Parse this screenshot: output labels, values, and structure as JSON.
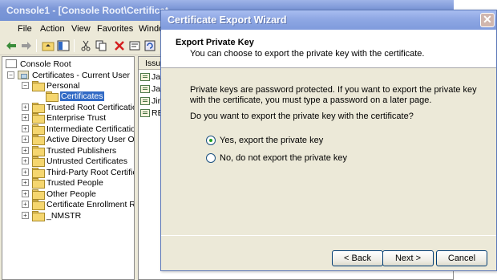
{
  "mmc": {
    "title": "Console1 - [Console Root\\Certificat",
    "menu": [
      "File",
      "Action",
      "View",
      "Favorites",
      "Windo"
    ],
    "toolbar_icons": [
      "back-arrow-icon",
      "forward-arrow-icon",
      "up-folder-icon",
      "show-tree-icon",
      "cut-icon",
      "copy-icon",
      "delete-icon",
      "properties-icon",
      "refresh-icon"
    ],
    "tree": {
      "root": "Console Root",
      "certificates_current_user": "Certificates - Current User",
      "personal": "Personal",
      "certificates": "Certificates",
      "stores": [
        "Trusted Root Certification A",
        "Enterprise Trust",
        "Intermediate Certification A",
        "Active Directory User Objec",
        "Trusted Publishers",
        "Untrusted Certificates",
        "Third-Party Root Certificatio",
        "Trusted People",
        "Other People",
        "Certificate Enrollment Requ",
        "_NMSTR"
      ]
    },
    "list": {
      "header": "Issu",
      "rows": [
        "Ja",
        "Ja",
        "Jir",
        "RE"
      ]
    }
  },
  "wizard": {
    "title": "Certificate Export Wizard",
    "close_glyph": "✕",
    "heading": "Export Private Key",
    "subheading": "You can choose to export the private key with the certificate.",
    "paragraph": "Private keys are password protected. If you want to export the private key with the certificate, you must type a password on a later page.",
    "question": "Do you want to export the private key with the certificate?",
    "option_yes": "Yes, export the private key",
    "option_no": "No, do not export the private key",
    "selected_option": "yes",
    "buttons": {
      "back": "< Back",
      "next": "Next >",
      "cancel": "Cancel"
    }
  },
  "colors": {
    "titlebar_active": "#7f9bdc",
    "titlebar_inactive": "#7d98d8",
    "selection": "#316ac5",
    "radio_dot": "#21a121"
  }
}
